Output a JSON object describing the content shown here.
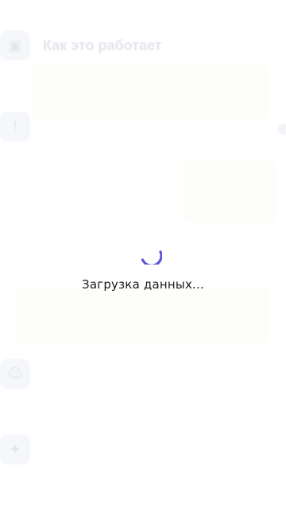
{
  "background": {
    "section_title": "Как это работает",
    "icons": [
      "certificate-icon",
      "info-icon",
      "people-icon",
      "gift-icon"
    ]
  },
  "loader": {
    "text": "Загрузка данных...",
    "spinner_color": "#5a55d6"
  }
}
